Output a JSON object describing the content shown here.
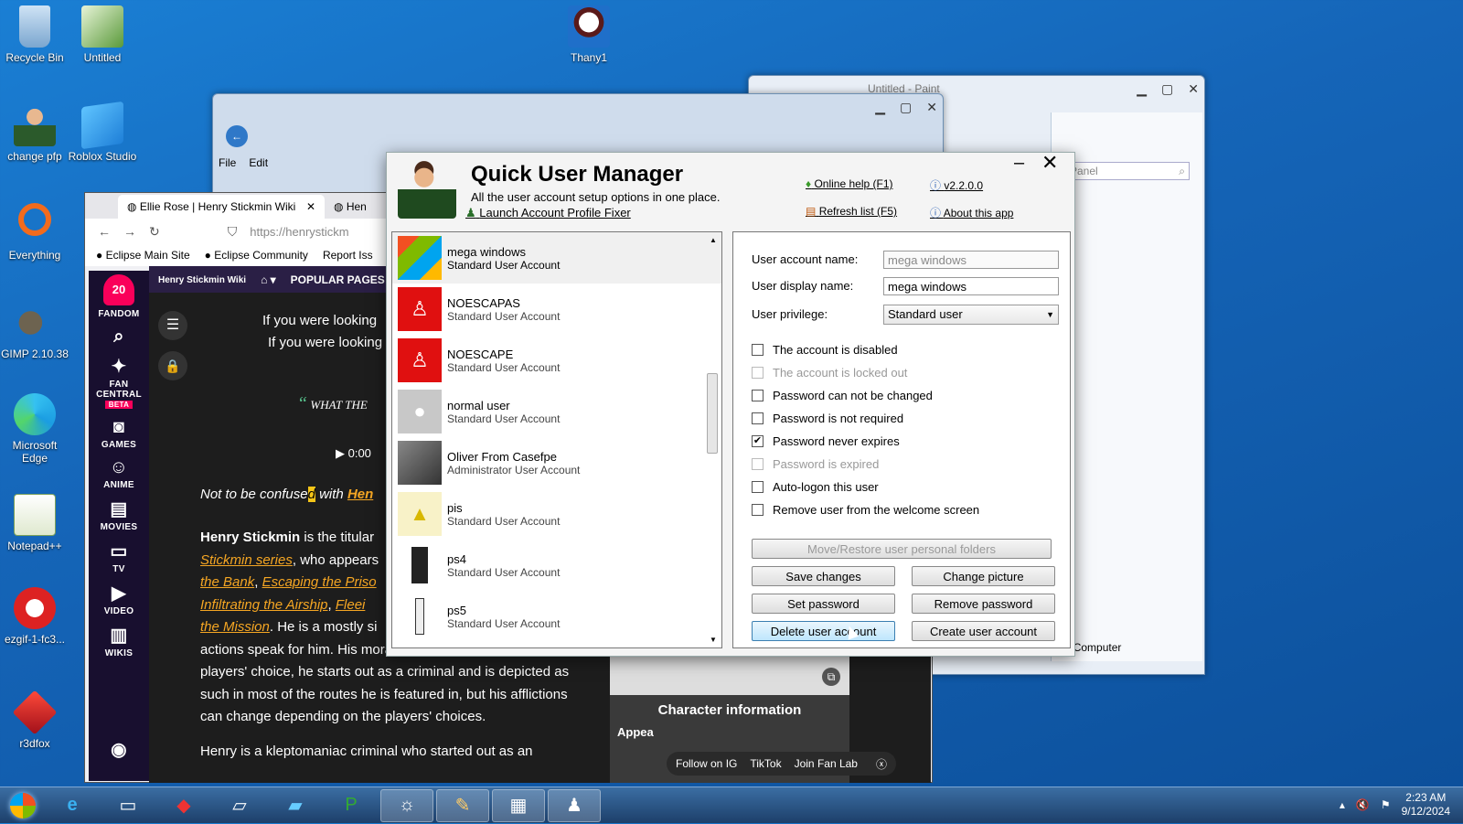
{
  "desktop_icons": [
    {
      "label": "Recycle Bin",
      "icon": "recycle-bin-icon"
    },
    {
      "label": "Untitled",
      "icon": "image-file-icon"
    },
    {
      "label": "Thany1",
      "icon": "character-icon"
    },
    {
      "label": "change pfp",
      "icon": "user-icon"
    },
    {
      "label": "Roblox Studio",
      "icon": "roblox-studio-icon"
    },
    {
      "label": "Everything",
      "icon": "search-app-icon"
    },
    {
      "label": "GIMP 2.10.38",
      "icon": "gimp-icon"
    },
    {
      "label": "Microsoft Edge",
      "icon": "edge-icon"
    },
    {
      "label": "Notepad++",
      "icon": "notepad-icon"
    },
    {
      "label": "ezgif-1-fc3...",
      "icon": "gif-icon"
    },
    {
      "label": "r3dfox",
      "icon": "r3dfox-icon"
    }
  ],
  "paint_window": {
    "title": "Untitled - Paint",
    "search_placeholder": "l Panel",
    "status": "Computer"
  },
  "explorer_window": {
    "menu": [
      "File",
      "Edit"
    ]
  },
  "browser": {
    "tabs": [
      {
        "label": "Ellie Rose | Henry Stickmin Wiki"
      },
      {
        "label": "Hen"
      }
    ],
    "url": "https://henrystickm",
    "bookmarks": [
      "Eclipse Main Site",
      "Eclipse Community",
      "Report Iss"
    ],
    "wiki_name": "Henry Stickmin Wiki",
    "nav_popular": "POPULAR PAGES",
    "rail": {
      "badge": "20",
      "items": [
        "FANDOM",
        "FAN CENTRAL",
        "BETA",
        "GAMES",
        "ANIME",
        "MOVIES",
        "TV",
        "VIDEO",
        "WIKIS"
      ]
    },
    "article": {
      "hat1": "If you were looking",
      "hat2": "If you were looking",
      "quote": "WHAT THE",
      "time": "0:00",
      "confuse_a": "Not to be confuse",
      "confuse_b": "d",
      "confuse_c": " with ",
      "confuse_link": "Hen",
      "bio1_bold": "Henry Stickmin",
      "bio1_rest": " is the titular",
      "bio2_link": "Stickmin series",
      "bio2_rest": ", who appears",
      "bio3_a": "the Bank",
      "bio3_b": "Escaping the Priso",
      "bio4_a": "Infiltrating the Airship",
      "bio4_b": "Fleei",
      "bio5_a": "the Mission",
      "bio5_b": ". He is a mostly si",
      "line6": "actions speak for him. His morality is dependent on the",
      "line7": "players' choice, he starts out as a criminal and is depicted as",
      "line8": "such in most of the routes he is featured in, but his afflictions",
      "line9": "can change depending on the players' choices.",
      "line10": "Henry is a kleptomaniac criminal who started out as an",
      "char_info": "Character information",
      "appear": "Appea",
      "social": [
        "Follow on IG",
        "TikTok",
        "Join Fan Lab"
      ]
    }
  },
  "dialog": {
    "title": "Quick User Manager",
    "subtitle": "All the user account setup options in one place.",
    "launch_fixer": "Launch Account Profile Fixer",
    "online_help": "Online help (F1)",
    "version": "v2.2.0.0",
    "refresh": "Refresh list (F5)",
    "about": "About this app",
    "users": [
      {
        "name": "mega windows",
        "type": "Standard User Account",
        "icon": "windows-logo-icon",
        "color": "#7ab648"
      },
      {
        "name": "NOESCAPAS",
        "type": "Standard User Account",
        "icon": "red-avatar-icon",
        "color": "#e01010"
      },
      {
        "name": "NOESCAPE",
        "type": "Standard User Account",
        "icon": "red-avatar-icon",
        "color": "#e01010"
      },
      {
        "name": "normal user",
        "type": "Standard User Account",
        "icon": "default-user-icon",
        "color": "#c8c8c8"
      },
      {
        "name": "Oliver From Casefpe",
        "type": "Administrator User Account",
        "icon": "photo-avatar-icon",
        "color": "#666666"
      },
      {
        "name": "pis",
        "type": "Standard User Account",
        "icon": "yellow-avatar-icon",
        "color": "#f3e8a0"
      },
      {
        "name": "ps4",
        "type": "Standard User Account",
        "icon": "console-icon",
        "color": "#222222"
      },
      {
        "name": "ps5",
        "type": "Standard User Account",
        "icon": "console-icon",
        "color": "#eeeeee"
      }
    ],
    "props": {
      "account_name_label": "User account name:",
      "account_name_value": "mega windows",
      "display_name_label": "User display name:",
      "display_name_value": "mega windows",
      "privilege_label": "User privilege:",
      "privilege_value": "Standard user",
      "checks": [
        {
          "label": "The account is disabled",
          "checked": false,
          "disabled": false
        },
        {
          "label": "The account is locked out",
          "checked": false,
          "disabled": true
        },
        {
          "label": "Password can not be changed",
          "checked": false,
          "disabled": false
        },
        {
          "label": "Password is not required",
          "checked": false,
          "disabled": false
        },
        {
          "label": "Password never expires",
          "checked": true,
          "disabled": false
        },
        {
          "label": "Password is expired",
          "checked": false,
          "disabled": true
        },
        {
          "label": "Auto-logon this user",
          "checked": false,
          "disabled": false
        },
        {
          "label": "Remove user from the welcome screen",
          "checked": false,
          "disabled": false
        }
      ],
      "move_restore": "Move/Restore user personal folders",
      "save": "Save changes",
      "change_picture": "Change picture",
      "set_password": "Set password",
      "remove_password": "Remove password",
      "delete_user": "Delete user account",
      "create_user": "Create user account"
    }
  },
  "taskbar": {
    "time": "2:23 AM",
    "date": "9/12/2024",
    "apps": [
      "internet-explorer-icon",
      "file-explorer-icon",
      "r3dfox-icon",
      "paper-icon",
      "app-icon",
      "publisher-icon",
      "settings-icon",
      "paint-icon",
      "control-panel-icon",
      "user-manager-icon"
    ]
  }
}
